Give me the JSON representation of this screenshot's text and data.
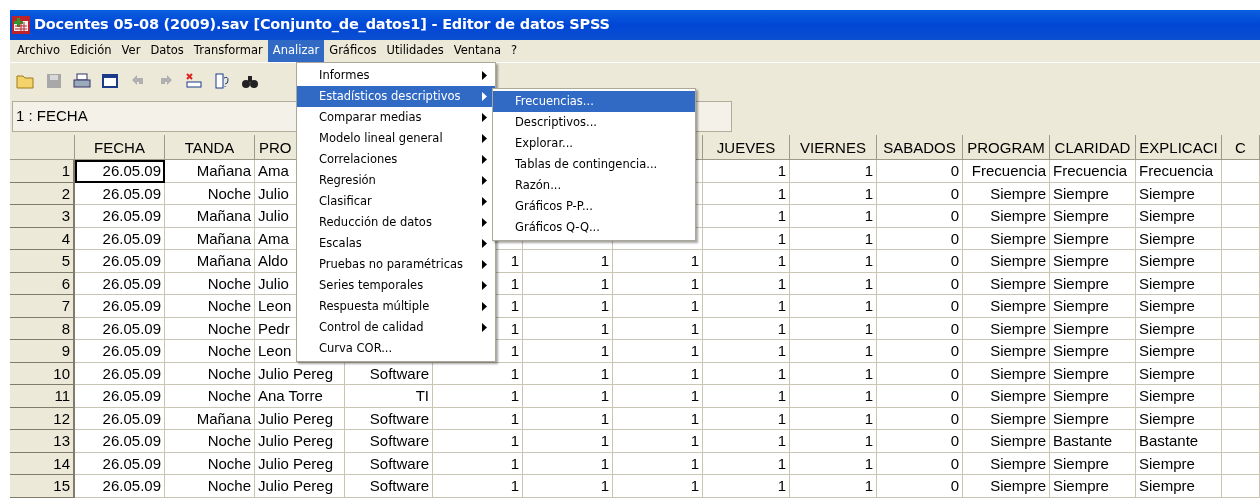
{
  "window": {
    "title": "Docentes 05-08 (2009).sav [Conjunto_de_datos1] - Editor de datos SPSS"
  },
  "menu_bar": [
    {
      "label": "Archivo",
      "selected": false
    },
    {
      "label": "Edición",
      "selected": false
    },
    {
      "label": "Ver",
      "selected": false
    },
    {
      "label": "Datos",
      "selected": false
    },
    {
      "label": "Transformar",
      "selected": false
    },
    {
      "label": "Analizar",
      "selected": true
    },
    {
      "label": "Gráficos",
      "selected": false
    },
    {
      "label": "Utilidades",
      "selected": false
    },
    {
      "label": "Ventana",
      "selected": false
    },
    {
      "label": "?",
      "selected": false
    }
  ],
  "cell_editor": {
    "label": "1 : FECHA"
  },
  "table": {
    "columns": [
      "FECHA",
      "TANDA",
      "PRO",
      null,
      null,
      null,
      null,
      "JUEVES",
      "VIERNES",
      "SABADOS",
      "PROGRAM",
      "CLARIDAD",
      "EXPLICACI",
      "C"
    ],
    "rows": [
      {
        "number": "1",
        "selected": true,
        "cells": [
          "26.05.09",
          "Mañana",
          "Ama",
          null,
          null,
          null,
          null,
          "1",
          "1",
          "0",
          "Frecuencia",
          "Frecuencia",
          "Frecuencia"
        ]
      },
      {
        "number": "2",
        "selected": false,
        "cells": [
          "26.05.09",
          "Noche",
          "Julio",
          null,
          null,
          null,
          null,
          "1",
          "1",
          "0",
          "Siempre",
          "Siempre",
          "Siempre"
        ]
      },
      {
        "number": "3",
        "selected": false,
        "cells": [
          "26.05.09",
          "Mañana",
          "Julio",
          null,
          null,
          null,
          null,
          "1",
          "1",
          "0",
          "Siempre",
          "Siempre",
          "Siempre"
        ]
      },
      {
        "number": "4",
        "selected": false,
        "cells": [
          "26.05.09",
          "Mañana",
          "Ama",
          null,
          null,
          null,
          null,
          "1",
          "1",
          "0",
          "Siempre",
          "Siempre",
          "Siempre"
        ]
      },
      {
        "number": "5",
        "selected": false,
        "cells": [
          "26.05.09",
          "Mañana",
          "Aldo",
          null,
          "1",
          "1",
          "1",
          "1",
          "1",
          "0",
          "Siempre",
          "Siempre",
          "Siempre"
        ]
      },
      {
        "number": "6",
        "selected": false,
        "cells": [
          "26.05.09",
          "Noche",
          "Julio",
          null,
          "1",
          "1",
          "1",
          "1",
          "1",
          "0",
          "Siempre",
          "Siempre",
          "Siempre"
        ]
      },
      {
        "number": "7",
        "selected": false,
        "cells": [
          "26.05.09",
          "Noche",
          "Leon",
          null,
          "1",
          "1",
          "1",
          "1",
          "1",
          "0",
          "Siempre",
          "Siempre",
          "Siempre"
        ]
      },
      {
        "number": "8",
        "selected": false,
        "cells": [
          "26.05.09",
          "Noche",
          "Pedr",
          null,
          "1",
          "1",
          "1",
          "1",
          "1",
          "0",
          "Siempre",
          "Siempre",
          "Siempre"
        ]
      },
      {
        "number": "9",
        "selected": false,
        "cells": [
          "26.05.09",
          "Noche",
          "Leon",
          null,
          "1",
          "1",
          "1",
          "1",
          "1",
          "0",
          "Siempre",
          "Siempre",
          "Siempre"
        ]
      },
      {
        "number": "10",
        "selected": false,
        "cells": [
          "26.05.09",
          "Noche",
          "Julio Pereg",
          "Software",
          "1",
          "1",
          "1",
          "1",
          "1",
          "0",
          "Siempre",
          "Siempre",
          "Siempre"
        ]
      },
      {
        "number": "11",
        "selected": false,
        "cells": [
          "26.05.09",
          "Noche",
          "Ana Torre",
          "TI",
          "1",
          "1",
          "1",
          "1",
          "1",
          "0",
          "Siempre",
          "Siempre",
          "Siempre"
        ]
      },
      {
        "number": "12",
        "selected": false,
        "cells": [
          "26.05.09",
          "Mañana",
          "Julio Pereg",
          "Software",
          "1",
          "1",
          "1",
          "1",
          "1",
          "0",
          "Siempre",
          "Siempre",
          "Siempre"
        ]
      },
      {
        "number": "13",
        "selected": false,
        "cells": [
          "26.05.09",
          "Noche",
          "Julio Pereg",
          "Software",
          "1",
          "1",
          "1",
          "1",
          "1",
          "0",
          "Siempre",
          "Bastante",
          "Bastante"
        ]
      },
      {
        "number": "14",
        "selected": false,
        "cells": [
          "26.05.09",
          "Noche",
          "Julio Pereg",
          "Software",
          "1",
          "1",
          "1",
          "1",
          "1",
          "0",
          "Siempre",
          "Siempre",
          "Siempre"
        ]
      },
      {
        "number": "15",
        "selected": false,
        "cells": [
          "26.05.09",
          "Noche",
          "Julio Pereg",
          "Software",
          "1",
          "1",
          "1",
          "1",
          "1",
          "0",
          "Siempre",
          "Siempre",
          "Siempre"
        ]
      }
    ]
  },
  "menu": {
    "items": [
      {
        "label": "Informes",
        "has_submenu": true,
        "selected": false
      },
      {
        "label": "Estadísticos descriptivos",
        "has_submenu": true,
        "selected": true
      },
      {
        "label": "Comparar medias",
        "has_submenu": true,
        "selected": false
      },
      {
        "label": "Modelo lineal general",
        "has_submenu": true,
        "selected": false
      },
      {
        "label": "Correlaciones",
        "has_submenu": true,
        "selected": false
      },
      {
        "label": "Regresión",
        "has_submenu": true,
        "selected": false
      },
      {
        "label": "Clasificar",
        "has_submenu": true,
        "selected": false
      },
      {
        "label": "Reducción de datos",
        "has_submenu": true,
        "selected": false
      },
      {
        "label": "Escalas",
        "has_submenu": true,
        "selected": false
      },
      {
        "label": "Pruebas no paramétricas",
        "has_submenu": true,
        "selected": false
      },
      {
        "label": "Series temporales",
        "has_submenu": true,
        "selected": false
      },
      {
        "label": "Respuesta múltiple",
        "has_submenu": true,
        "selected": false
      },
      {
        "label": "Control de calidad",
        "has_submenu": true,
        "selected": false
      },
      {
        "label": "Curva COR...",
        "has_submenu": false,
        "selected": false
      }
    ]
  },
  "submenu": {
    "items": [
      {
        "label": "Frecuencias...",
        "selected": true
      },
      {
        "label": "Descriptivos...",
        "selected": false
      },
      {
        "label": "Explorar...",
        "selected": false
      },
      {
        "label": "Tablas de contingencia...",
        "selected": false
      },
      {
        "label": "Razón...",
        "selected": false
      },
      {
        "label": "Gráficos P-P...",
        "selected": false
      },
      {
        "label": "Gráficos Q-Q...",
        "selected": false
      }
    ]
  }
}
